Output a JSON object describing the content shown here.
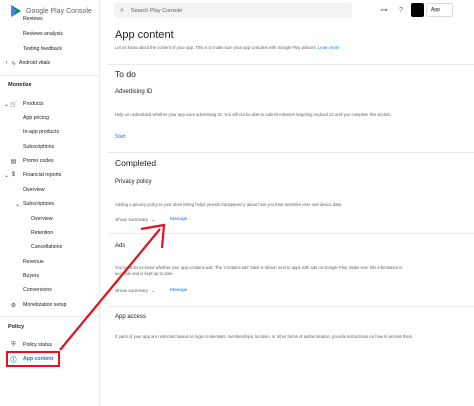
{
  "brand": {
    "logo_text": "Google Play Console"
  },
  "sidebar": {
    "top_items": [
      {
        "label": "Reviews",
        "icon": "none"
      },
      {
        "label": "Reviews analysis",
        "icon": "none"
      },
      {
        "label": "Testing feedback",
        "icon": "none"
      },
      {
        "label": "Android vitals",
        "icon": "vitals-icon"
      }
    ],
    "monetize_title": "Monetize",
    "monetize_items": [
      {
        "label": "Products",
        "icon": "cart-icon"
      },
      {
        "label": "App pricing",
        "icon": "none"
      },
      {
        "label": "In-app products",
        "icon": "none"
      },
      {
        "label": "Subscriptions",
        "icon": "none"
      },
      {
        "label": "Promo codes",
        "icon": "promo-icon"
      },
      {
        "label": "Financial reports",
        "icon": "dollar-icon"
      },
      {
        "label": "Overview",
        "icon": "none"
      },
      {
        "label": "Subscriptions",
        "icon": "none"
      },
      {
        "label": "Overview",
        "icon": "none"
      },
      {
        "label": "Retention",
        "icon": "none"
      },
      {
        "label": "Cancellations",
        "icon": "none"
      },
      {
        "label": "Revenue",
        "icon": "none"
      },
      {
        "label": "Buyers",
        "icon": "none"
      },
      {
        "label": "Conversions",
        "icon": "none"
      },
      {
        "label": "Monetization setup",
        "icon": "settings-icon"
      }
    ],
    "policy_title": "Policy",
    "policy_items": [
      {
        "label": "Policy status",
        "icon": "shield-icon"
      },
      {
        "label": "App content",
        "icon": "info-icon"
      }
    ]
  },
  "topbar": {
    "search_placeholder": "Search Play Console",
    "app_button_label": "App"
  },
  "main": {
    "title": "App content",
    "intro_text": "Let us know about the content of your app. This is to make sure your app complies with Google Play policies.",
    "intro_link": "Learn more",
    "todo": {
      "heading": "To do",
      "advertising": {
        "title": "Advertising ID",
        "description": "Help us understand whether your app uses advertising ID. You will not be able to submit releases targeting Android 13 until you complete this section.",
        "action": "Start"
      }
    },
    "completed": {
      "heading": "Completed",
      "privacy": {
        "title": "Privacy policy",
        "description": "Adding a privacy policy to your store listing helps provide transparency about how you treat sensitive user and device data.",
        "summary": "Show summary",
        "manage": "Manage"
      },
      "ads": {
        "title": "Ads",
        "description": "You must let us know whether your app contains ads. The 'Contains ads' label is shown next to apps with ads on Google Play. Make sure this information is accurate and is kept up to date.",
        "summary": "Show summary",
        "manage": "Manage"
      },
      "access": {
        "title": "App access",
        "description": "If parts of your app are restricted based on login credentials, memberships, location, or other forms of authentication, provide instructions on how to access them."
      }
    }
  },
  "colors": {
    "accent": "#1a73e8",
    "annotation": "#e8101d"
  }
}
